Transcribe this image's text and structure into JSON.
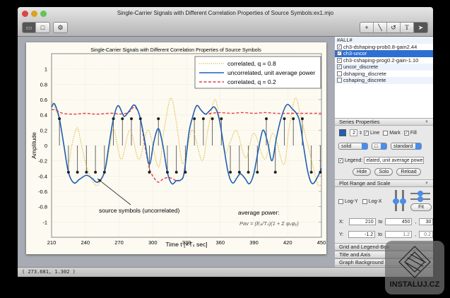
{
  "window": {
    "title": "Single-Carrier Signals with Different Correlation Properties of Source Symbols:ex1.mjo"
  },
  "toolbar": {
    "left": [
      "layout-icon",
      "single-view-icon",
      "gear-icon"
    ],
    "right": [
      "crosshair-icon",
      "line-icon",
      "rotate-icon",
      "T",
      "pointer-icon"
    ],
    "text_tool": "T"
  },
  "series_list": [
    {
      "label": "#ALL#",
      "checked": null,
      "selected": false
    },
    {
      "label": "ch3-dshaping-prob0.8-gain2.44",
      "checked": true,
      "selected": false
    },
    {
      "label": "ch3-uncor",
      "checked": true,
      "selected": true
    },
    {
      "label": "ch3-cshaping-prog0.2-gain-1.10",
      "checked": true,
      "selected": false
    },
    {
      "label": "uncor_discrete",
      "checked": true,
      "selected": false
    },
    {
      "label": "dshaping_discrete",
      "checked": false,
      "selected": false
    },
    {
      "label": "cshaping_discrete",
      "checked": false,
      "selected": false
    }
  ],
  "series_properties": {
    "header": "Series Properties",
    "color": "#1f5fb4",
    "width": "2",
    "line_label": "Line",
    "line": true,
    "mark_label": "Mark",
    "mark": false,
    "fill_label": "Fill",
    "fill": true,
    "style": "solid",
    "marker": "□",
    "mode": "standard",
    "legend_label": "Legend:",
    "legend_checked": true,
    "legend_value": "elated, unit average power",
    "hide": "Hide",
    "solo": "Solo",
    "reload": "Reload"
  },
  "plot_range": {
    "header": "Plot Range and Scale",
    "logy": "Log-Y",
    "logx": "Log-X",
    "fit": "Fit",
    "x_label": "X:",
    "x_from": "210",
    "to": "to",
    "x_to": "450",
    "x_step": "30",
    "y_label": "Y:",
    "y_from": "-1.2",
    "y_to": "1.2",
    "y_step": "0.2"
  },
  "sections": [
    "Grid and Legend-Box",
    "Title and Axis",
    "Graph Background"
  ],
  "status": "( 273.681,  1.302 )",
  "watermark": "INSTALUJ.CZ",
  "chart_data": {
    "type": "line",
    "title": "Single-Carrier Signals with Different Correlation Properties of Source Symbols",
    "xlabel": "Time t   [×Tₛ sec]",
    "ylabel": "Amplitude",
    "xlim": [
      210,
      450
    ],
    "ylim": [
      -1.2,
      1.2
    ],
    "xticks": [
      210,
      240,
      270,
      300,
      330,
      360,
      390,
      420,
      450
    ],
    "yticks": [
      "-1",
      "-0.8",
      "-0.6",
      "-0.4",
      "-0.2",
      "0",
      "0.2",
      "0.4",
      "0.6",
      "0.8",
      "1"
    ],
    "grid": true,
    "legend_position": "top-right",
    "legend": [
      "correlated, q = 0.8",
      "uncorrelated, unit average power",
      "correlated, q = 0.2"
    ],
    "annotations": {
      "symbols": "source symbols (uncorrelated)",
      "power_title": "average power:",
      "power_formula": "Pav = (Eₚ/Tₛ)(1 + Σ φₓφᵧ)"
    },
    "series": [
      {
        "name": "correlated, q = 0.8",
        "color": "#e0b440",
        "style": "dotted",
        "points": [
          [
            210,
            0.6
          ],
          [
            214,
            0.45
          ],
          [
            217.5,
            0.3
          ],
          [
            224,
            -0.25
          ],
          [
            228,
            0.0
          ],
          [
            232.6,
            0.23
          ],
          [
            236,
            0.05
          ],
          [
            240.6,
            -0.25
          ],
          [
            246,
            -0.45
          ],
          [
            251,
            -0.52
          ],
          [
            258,
            -0.3
          ],
          [
            262,
            0.0
          ],
          [
            265.3,
            0.22
          ],
          [
            272,
            -0.18
          ],
          [
            279.7,
            0.2
          ],
          [
            287.7,
            -0.18
          ],
          [
            296,
            0.2
          ],
          [
            305,
            -0.28
          ],
          [
            310,
            0.2
          ],
          [
            316,
            0.62
          ],
          [
            321,
            0.3
          ],
          [
            326,
            -0.22
          ],
          [
            330,
            -0.1
          ],
          [
            335.4,
            0.2
          ],
          [
            344,
            -0.2
          ],
          [
            349,
            0.2
          ],
          [
            355,
            0.6
          ],
          [
            360,
            0.3
          ],
          [
            364,
            -0.1
          ],
          [
            369,
            0.05
          ],
          [
            374.6,
            0.19
          ],
          [
            382.7,
            -0.16
          ],
          [
            390,
            0.16
          ],
          [
            399.7,
            -0.18
          ],
          [
            407,
            0.16
          ],
          [
            416.5,
            -0.25
          ],
          [
            421,
            0.2
          ],
          [
            426.8,
            0.62
          ],
          [
            432,
            0.35
          ],
          [
            438.5,
            -0.03
          ],
          [
            443,
            -0.3
          ],
          [
            447,
            -0.52
          ],
          [
            450,
            -0.5
          ]
        ]
      },
      {
        "name": "uncorrelated, unit average power",
        "color": "#1f5fb4",
        "style": "solid",
        "points": [
          [
            210,
            0.5
          ],
          [
            212,
            0.55
          ],
          [
            214,
            0.5
          ],
          [
            217,
            0.35
          ],
          [
            221,
            0
          ],
          [
            225,
            -0.35
          ],
          [
            230,
            -0.49
          ],
          [
            235,
            -0.44
          ],
          [
            241,
            -0.39
          ],
          [
            246,
            -0.43
          ],
          [
            251,
            -0.48
          ],
          [
            257,
            -0.35
          ],
          [
            261,
            0
          ],
          [
            265,
            0.35
          ],
          [
            269,
            0.52
          ],
          [
            273,
            0.42
          ],
          [
            275,
            0.38
          ],
          [
            279,
            0.45
          ],
          [
            283,
            0.53
          ],
          [
            286,
            0.48
          ],
          [
            289,
            0.35
          ],
          [
            293,
            0.05
          ],
          [
            297,
            -0.25
          ],
          [
            301,
            0.05
          ],
          [
            305,
            0.22
          ],
          [
            309,
            0
          ],
          [
            313,
            -0.35
          ],
          [
            317,
            -0.5
          ],
          [
            321,
            -0.46
          ],
          [
            325,
            -0.45
          ],
          [
            328,
            -0.35
          ],
          [
            332,
            0.15
          ],
          [
            335,
            0.35
          ],
          [
            339,
            0.52
          ],
          [
            343,
            0.46
          ],
          [
            347,
            0.41
          ],
          [
            351,
            0.46
          ],
          [
            355,
            0.5
          ],
          [
            359,
            0.35
          ],
          [
            363,
            0
          ],
          [
            367,
            -0.35
          ],
          [
            371,
            -0.49
          ],
          [
            375,
            -0.42
          ],
          [
            378,
            -0.37
          ],
          [
            382,
            -0.43
          ],
          [
            386,
            -0.5
          ],
          [
            390,
            -0.36
          ],
          [
            394,
            -0.05
          ],
          [
            398,
            0.2
          ],
          [
            402,
            0.05
          ],
          [
            406,
            -0.2
          ],
          [
            410,
            0.1
          ],
          [
            414,
            0.35
          ],
          [
            419,
            0.53
          ],
          [
            424,
            0.48
          ],
          [
            430,
            0.35
          ],
          [
            434,
            0
          ],
          [
            438,
            -0.35
          ],
          [
            442,
            -0.5
          ],
          [
            447,
            -0.4
          ],
          [
            450,
            -0.3
          ]
        ]
      },
      {
        "name": "correlated, q = 0.2",
        "color": "#e83a4a",
        "style": "dashed",
        "points": [
          [
            210,
            0.47
          ],
          [
            214,
            0.46
          ],
          [
            220,
            0.42
          ],
          [
            230,
            0.41
          ],
          [
            240,
            0.42
          ],
          [
            250,
            0.41
          ],
          [
            260,
            0.42
          ],
          [
            266,
            0.42
          ],
          [
            270,
            0.41
          ],
          [
            276,
            0.42
          ],
          [
            280,
            0.45
          ],
          [
            283,
            0.5
          ],
          [
            286,
            0.47
          ],
          [
            289,
            0.35
          ],
          [
            293,
            0.0
          ],
          [
            297,
            -0.3
          ],
          [
            301,
            -0.42
          ],
          [
            305,
            -0.48
          ],
          [
            309,
            -0.44
          ],
          [
            313,
            -0.42
          ],
          [
            317,
            -0.43
          ],
          [
            321,
            -0.46
          ],
          [
            325,
            -0.45
          ],
          [
            328,
            -0.35
          ],
          [
            332,
            0.15
          ],
          [
            335,
            0.35
          ],
          [
            339,
            0.52
          ],
          [
            343,
            0.46
          ],
          [
            347,
            0.41
          ],
          [
            352,
            0.42
          ],
          [
            360,
            0.43
          ],
          [
            370,
            0.42
          ],
          [
            380,
            0.43
          ],
          [
            390,
            0.42
          ],
          [
            400,
            0.43
          ],
          [
            410,
            0.42
          ],
          [
            420,
            0.42
          ],
          [
            430,
            0.42
          ],
          [
            440,
            0.42
          ],
          [
            450,
            0.42
          ]
        ]
      },
      {
        "name": "uncor_discrete",
        "color": "#222222",
        "style": "stem",
        "x_start": 217,
        "x_step": 8,
        "amplitude": 0.35,
        "symbols": [
          1,
          -1,
          -1,
          -1,
          -1,
          -1,
          1,
          1,
          1,
          1,
          -1,
          1,
          -1,
          -1,
          -1,
          1,
          1,
          1,
          1,
          -1,
          -1,
          -1,
          -1,
          1,
          -1,
          1,
          1,
          1,
          -1,
          -1
        ]
      }
    ]
  }
}
